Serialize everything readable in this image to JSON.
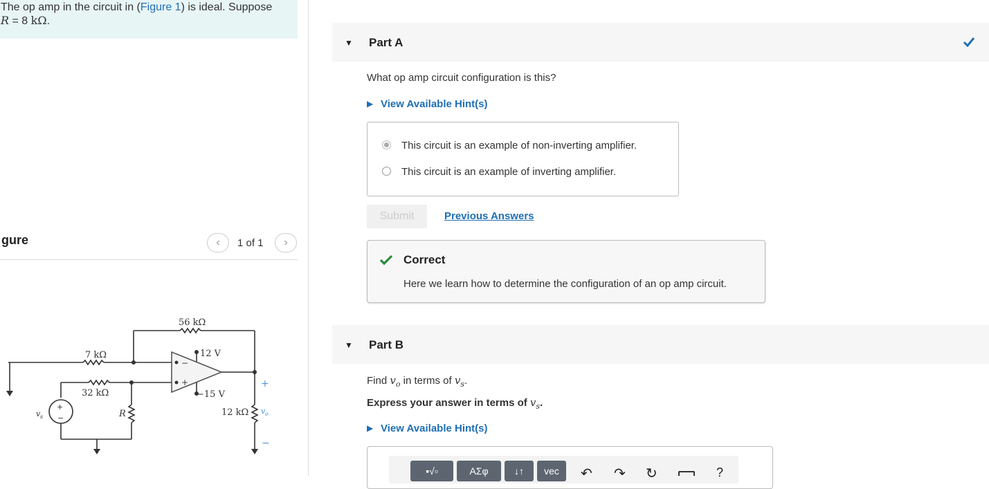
{
  "problem": {
    "text_before": "The op amp in the circuit in (",
    "figure_link": "Figure 1",
    "text_after": ") is ideal. Suppose",
    "r_symbol": "R",
    "r_value": " = 8 ",
    "r_unit": "kΩ",
    "period": "."
  },
  "figure": {
    "title": "gure",
    "pager": "1 of 1",
    "prev_icon": "‹",
    "next_icon": "›",
    "circuit_labels": {
      "r56": "56 kΩ",
      "r7": "7 kΩ",
      "r32": "32 kΩ",
      "v12": "12 V",
      "v15": "−15 V",
      "rR": "R",
      "r12": "12 kΩ",
      "vs": "v",
      "vs_sub": "s",
      "vo": "v",
      "vo_sub": "o",
      "plus": "+",
      "minus": "−",
      "opamp_plus": "+",
      "opamp_minus": "−"
    }
  },
  "partA": {
    "title": "Part A",
    "question": "What op amp circuit configuration is this?",
    "hint": "View Available Hint(s)",
    "options": [
      {
        "label": "This circuit is an example of non-inverting amplifier.",
        "selected": true
      },
      {
        "label": "This circuit is an example of inverting amplifier.",
        "selected": false
      }
    ],
    "submit": "Submit",
    "previous": "Previous Answers",
    "feedback_title": "Correct",
    "feedback_text": "Here we learn how to determine the configuration of an op amp circuit."
  },
  "partB": {
    "title": "Part B",
    "find_pre": "Find ",
    "var_vo": "v",
    "var_vo_sub": "o",
    "find_mid": " in terms of ",
    "var_vs": "v",
    "var_vs_sub": "s",
    "find_end": ".",
    "express_pre": "Express your answer in terms of ",
    "express_end": ".",
    "hint": "View Available Hint(s)",
    "toolbar": {
      "btn1": "▪√▫",
      "btn2": "ΑΣφ",
      "btn3": "↓↑",
      "btn4": "vec",
      "help": "?"
    }
  },
  "colors": {
    "accent": "#1f6fb5",
    "correct": "#2a8c3c",
    "problem_bg": "#e8f5f5"
  }
}
